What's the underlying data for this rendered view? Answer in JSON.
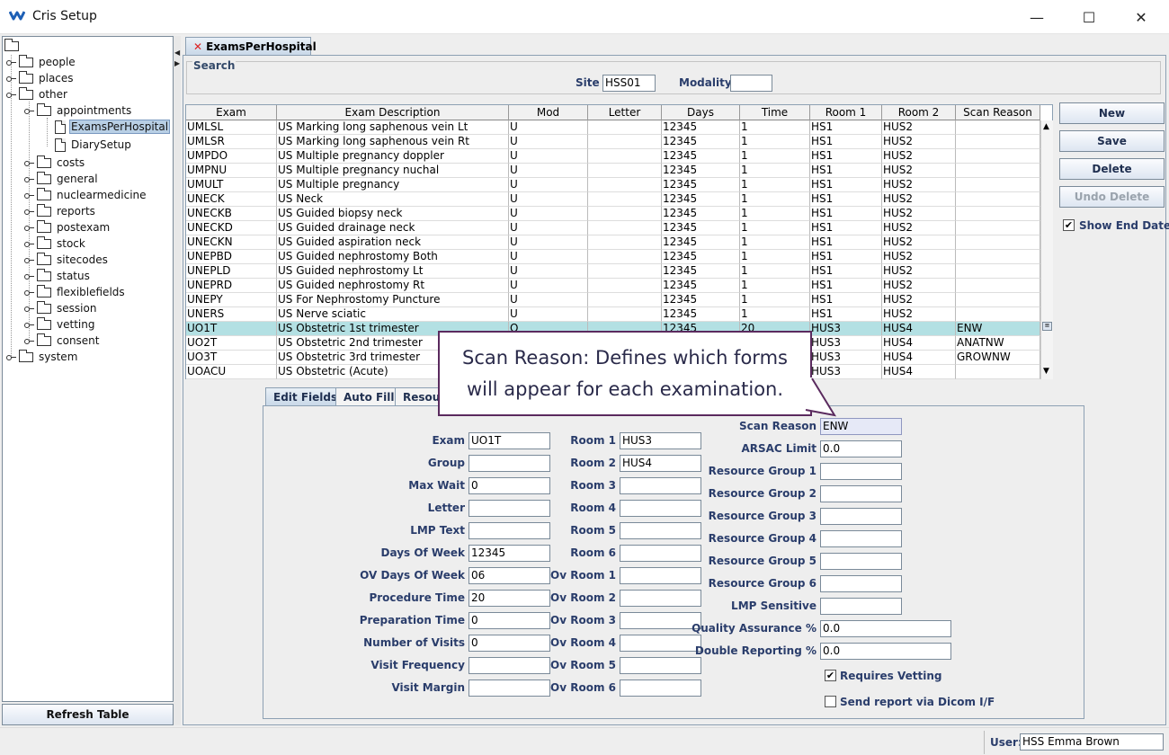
{
  "window": {
    "title": "Cris Setup",
    "minimize_glyph": "—",
    "maximize_glyph": "☐",
    "close_glyph": "✕"
  },
  "tree": {
    "items": [
      {
        "label": "people"
      },
      {
        "label": "places"
      },
      {
        "label": "other"
      },
      {
        "label": "appointments"
      },
      {
        "label": "ExamsPerHospital"
      },
      {
        "label": "DiarySetup"
      },
      {
        "label": "costs"
      },
      {
        "label": "general"
      },
      {
        "label": "nuclearmedicine"
      },
      {
        "label": "reports"
      },
      {
        "label": "postexam"
      },
      {
        "label": "stock"
      },
      {
        "label": "sitecodes"
      },
      {
        "label": "status"
      },
      {
        "label": "flexiblefields"
      },
      {
        "label": "session"
      },
      {
        "label": "vetting"
      },
      {
        "label": "consent"
      },
      {
        "label": "system"
      }
    ],
    "refresh_label": "Refresh Table"
  },
  "tab": {
    "label": "ExamsPerHospital",
    "close_glyph": "✕"
  },
  "search": {
    "title": "Search",
    "site_label": "Site",
    "site_value": "HSS01",
    "modality_label": "Modality",
    "modality_value": ""
  },
  "table": {
    "columns": [
      "Exam",
      "Exam Description",
      "Mod",
      "Letter",
      "Days",
      "Time",
      "Room 1",
      "Room 2",
      "Scan Reason"
    ],
    "rows": [
      [
        "UMLSL",
        "US Marking long saphenous vein Lt",
        "U",
        "",
        "12345",
        "1",
        "HS1",
        "HUS2",
        ""
      ],
      [
        "UMLSR",
        "US Marking long saphenous vein Rt",
        "U",
        "",
        "12345",
        "1",
        "HS1",
        "HUS2",
        ""
      ],
      [
        "UMPDO",
        "US Multiple pregnancy doppler",
        "U",
        "",
        "12345",
        "1",
        "HS1",
        "HUS2",
        ""
      ],
      [
        "UMPNU",
        "US Multiple pregnancy nuchal",
        "U",
        "",
        "12345",
        "1",
        "HS1",
        "HUS2",
        ""
      ],
      [
        "UMULT",
        "US Multiple pregnancy",
        "U",
        "",
        "12345",
        "1",
        "HS1",
        "HUS2",
        ""
      ],
      [
        "UNECK",
        "US Neck",
        "U",
        "",
        "12345",
        "1",
        "HS1",
        "HUS2",
        ""
      ],
      [
        "UNECKB",
        "US Guided biopsy neck",
        "U",
        "",
        "12345",
        "1",
        "HS1",
        "HUS2",
        ""
      ],
      [
        "UNECKD",
        "US Guided drainage neck",
        "U",
        "",
        "12345",
        "1",
        "HS1",
        "HUS2",
        ""
      ],
      [
        "UNECKN",
        "US Guided aspiration neck",
        "U",
        "",
        "12345",
        "1",
        "HS1",
        "HUS2",
        ""
      ],
      [
        "UNEPBD",
        "US Guided nephrostomy Both",
        "U",
        "",
        "12345",
        "1",
        "HS1",
        "HUS2",
        ""
      ],
      [
        "UNEPLD",
        "US Guided nephrostomy Lt",
        "U",
        "",
        "12345",
        "1",
        "HS1",
        "HUS2",
        ""
      ],
      [
        "UNEPRD",
        "US Guided nephrostomy Rt",
        "U",
        "",
        "12345",
        "1",
        "HS1",
        "HUS2",
        ""
      ],
      [
        "UNEPY",
        "US For Nephrostomy Puncture",
        "U",
        "",
        "12345",
        "1",
        "HS1",
        "HUS2",
        ""
      ],
      [
        "UNERS",
        "US Nerve sciatic",
        "U",
        "",
        "12345",
        "1",
        "HS1",
        "HUS2",
        ""
      ],
      [
        "UO1T",
        "US Obstetric 1st trimester",
        "O",
        "",
        "12345",
        "20",
        "HUS3",
        "HUS4",
        "ENW"
      ],
      [
        "UO2T",
        "US Obstetric 2nd trimester",
        "",
        "",
        "",
        "",
        "HUS3",
        "HUS4",
        "ANATNW"
      ],
      [
        "UO3T",
        "US Obstetric 3rd trimester",
        "",
        "",
        "",
        "",
        "HUS3",
        "HUS4",
        "GROWNW"
      ],
      [
        "UOACU",
        "US Obstetric (Acute)",
        "",
        "",
        "",
        "",
        "HUS3",
        "HUS4",
        ""
      ]
    ],
    "selected_row": 14
  },
  "actions": {
    "new": "New",
    "save": "Save",
    "delete": "Delete",
    "undo_delete": "Undo Delete",
    "show_end_dated": "Show End Dated"
  },
  "edit_tabs": [
    "Edit Fields",
    "Auto Fill",
    "Resour"
  ],
  "edit": {
    "col1": [
      {
        "label": "Exam",
        "value": "UO1T"
      },
      {
        "label": "Group",
        "value": ""
      },
      {
        "label": "Max Wait",
        "value": "0"
      },
      {
        "label": "Letter",
        "value": ""
      },
      {
        "label": "LMP Text",
        "value": ""
      },
      {
        "label": "Days Of Week",
        "value": "12345"
      },
      {
        "label": "OV Days Of Week",
        "value": "06"
      },
      {
        "label": "Procedure Time",
        "value": "20"
      },
      {
        "label": "Preparation Time",
        "value": "0"
      },
      {
        "label": "Number of Visits",
        "value": "0"
      },
      {
        "label": "Visit Frequency",
        "value": ""
      },
      {
        "label": "Visit Margin",
        "value": ""
      }
    ],
    "col2": [
      {
        "label": "Room 1",
        "value": "HUS3"
      },
      {
        "label": "Room 2",
        "value": "HUS4"
      },
      {
        "label": "Room 3",
        "value": ""
      },
      {
        "label": "Room 4",
        "value": ""
      },
      {
        "label": "Room 5",
        "value": ""
      },
      {
        "label": "Room 6",
        "value": ""
      },
      {
        "label": "Ov Room 1",
        "value": ""
      },
      {
        "label": "Ov Room 2",
        "value": ""
      },
      {
        "label": "Ov Room 3",
        "value": ""
      },
      {
        "label": "Ov Room 4",
        "value": ""
      },
      {
        "label": "Ov Room 5",
        "value": ""
      },
      {
        "label": "Ov Room 6",
        "value": ""
      }
    ],
    "col3": [
      {
        "label": "Scan Reason",
        "value": "ENW"
      },
      {
        "label": "ARSAC Limit",
        "value": "0.0"
      },
      {
        "label": "Resource Group 1",
        "value": ""
      },
      {
        "label": "Resource Group 2",
        "value": ""
      },
      {
        "label": "Resource Group 3",
        "value": ""
      },
      {
        "label": "Resource Group 4",
        "value": ""
      },
      {
        "label": "Resource Group 5",
        "value": ""
      },
      {
        "label": "Resource Group 6",
        "value": ""
      },
      {
        "label": "LMP Sensitive",
        "value": ""
      },
      {
        "label": "Quality Assurance %",
        "value": "0.0"
      },
      {
        "label": "Double Reporting %",
        "value": "0.0"
      }
    ],
    "requires_vetting": "Requires Vetting",
    "send_report": "Send report via Dicom I/F"
  },
  "callout": {
    "line1": "Scan Reason: Defines which forms",
    "line2": "will appear for each examination."
  },
  "status": {
    "user_label": "User:",
    "user_value": "HSS Emma Brown"
  }
}
